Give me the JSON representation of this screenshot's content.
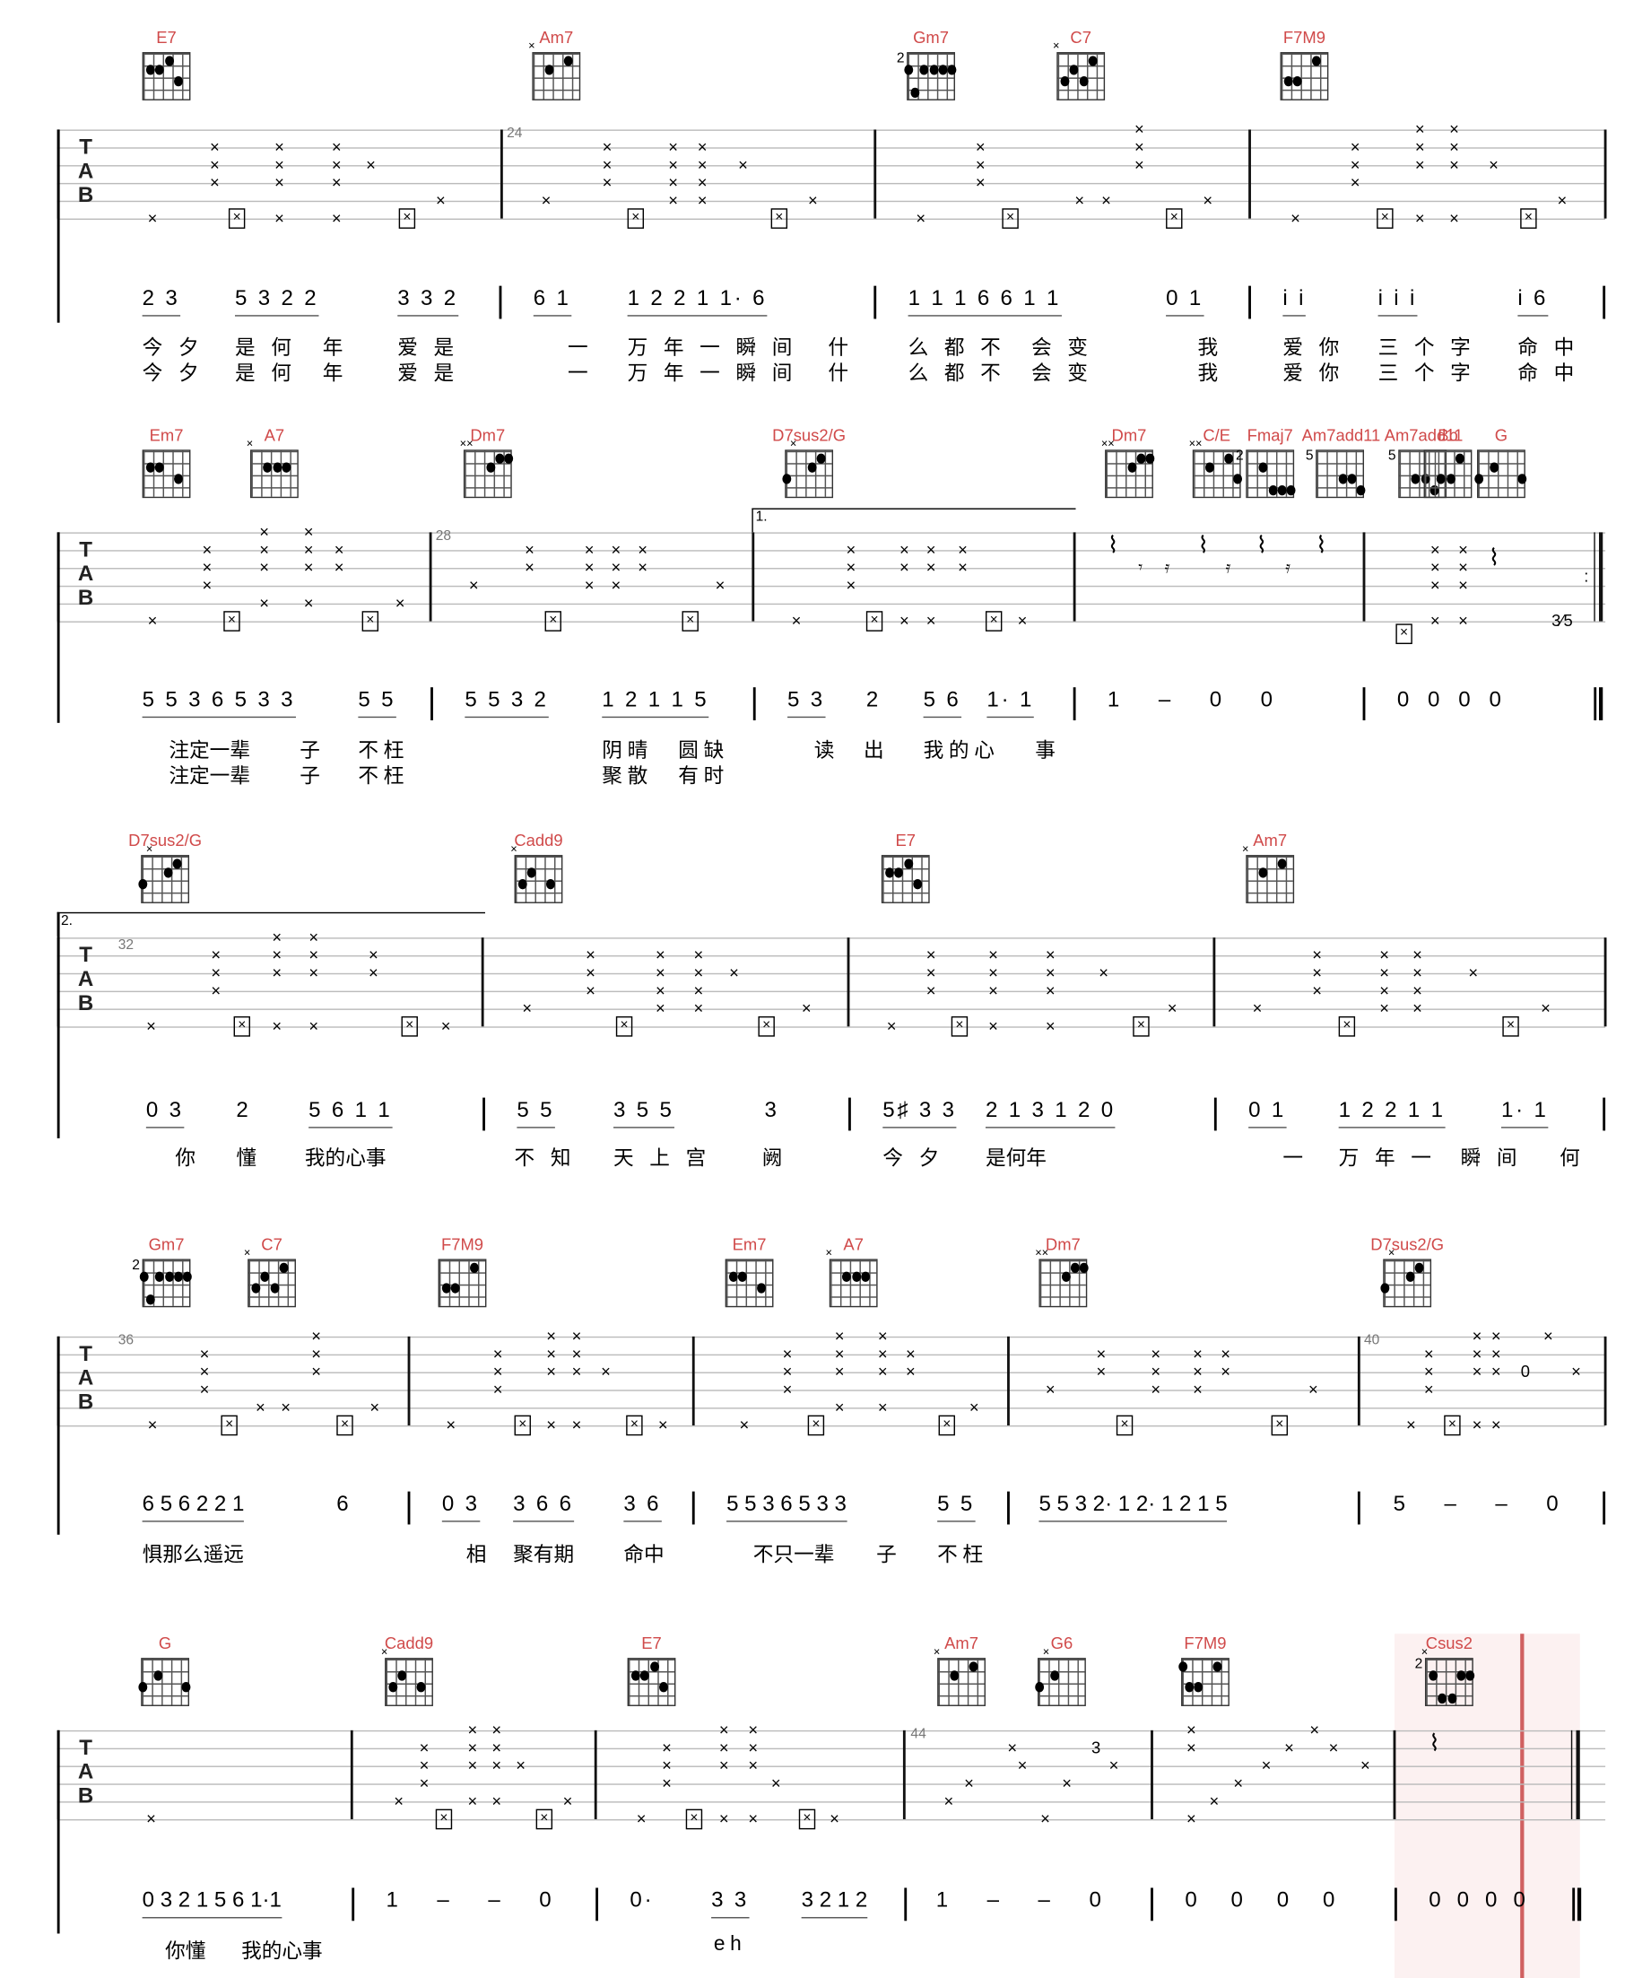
{
  "score": {
    "tab_label": "TAB",
    "systems": [
      {
        "chords": [
          "E7",
          "Am7",
          "Gm7",
          "C7",
          "F7M9"
        ],
        "measure_numbers": [
          "24"
        ],
        "jianpu": [
          "2 3",
          "5 3 2 2",
          "3 3 2",
          "6 1",
          "1 2 2 1 1· 6",
          "1 1 1 6 6 1 1",
          "0 1",
          "i i",
          "i i i",
          "i 6"
        ],
        "lyrics_1": [
          "今 夕",
          "是 何",
          "年",
          "爱 是",
          "一",
          "万 年 一 瞬 间",
          "什",
          "么 都 不",
          "会 变",
          "我",
          "爱 你",
          "三 个 字",
          "命 中"
        ],
        "lyrics_2": [
          "今 夕",
          "是 何",
          "年",
          "爱 是",
          "一",
          "万 年 一 瞬 间",
          "什",
          "么 都 不",
          "会 变",
          "我",
          "爱 你",
          "三 个 字",
          "命 中"
        ]
      },
      {
        "chords": [
          "Em7",
          "A7",
          "Dm7",
          "D7sus2/G",
          "Dm7",
          "C/E",
          "Fmaj7",
          "Am7add11",
          "Am7add11",
          "Bb",
          "G"
        ],
        "measure_numbers": [
          "28"
        ],
        "volta": "1.",
        "fret_label": "3⁄5",
        "jianpu": [
          "5 5 3 6 5 3 3",
          "5 5",
          "5 5 3 2",
          "1 2 1 1 5",
          "5 3",
          "2",
          "5 6",
          "1· 1",
          "1 – 0 0",
          "0 0 0 0"
        ],
        "lyrics_1": [
          "注定一辈",
          "子",
          "不枉",
          "阴晴",
          "圆缺",
          "读",
          "出",
          "我的心",
          "事"
        ],
        "lyrics_2": [
          "注定一辈",
          "子",
          "不枉",
          "聚散",
          "有时"
        ]
      },
      {
        "chords": [
          "D7sus2/G",
          "Cadd9",
          "E7",
          "Am7"
        ],
        "measure_numbers": [
          "32"
        ],
        "volta": "2.",
        "jianpu": [
          "0 3",
          "2",
          "5 6 1 1",
          "5 5",
          "3 5 5",
          "3",
          "5♯ 3 3",
          "2 1 3 1 2 0",
          "0 1",
          "1 2 2 1 1",
          "1· 1"
        ],
        "lyrics_1": [
          "你",
          "懂",
          "我的心事",
          "不 知",
          "天 上 宫",
          "阙",
          "今 夕",
          "是何年",
          "一",
          "万 年 一",
          "瞬 间",
          "何"
        ]
      },
      {
        "chords": [
          "Gm7",
          "C7",
          "F7M9",
          "Em7",
          "A7",
          "Dm7",
          "D7sus2/G"
        ],
        "measure_numbers": [
          "36",
          "40"
        ],
        "fret_label": "0",
        "jianpu": [
          "6 5 6 2 2 1",
          "6",
          "0 3",
          "3 6 6",
          "3 6",
          "5 5 3 6 5 3 3",
          "5 5",
          "5 5 3 2· 1 2· 1 2 1 5",
          "5 – – 0"
        ],
        "lyrics_1": [
          "惧那么遥远",
          "相",
          "聚有期",
          "命中",
          "不只一辈",
          "子",
          "不枉"
        ]
      },
      {
        "chords": [
          "G",
          "Cadd9",
          "E7",
          "Am7",
          "G6",
          "F7M9",
          "Csus2"
        ],
        "measure_numbers": [
          "44"
        ],
        "fret_label": "3",
        "jianpu": [
          "0 3 2 1 5 6 1·1",
          "1 – – 0",
          "0·",
          "3 3",
          "3 2 1 2",
          "1 – – 0",
          "0 0 0 0",
          "0 0 0 0"
        ],
        "lyrics_1": [
          "你懂",
          "我的心事",
          "eh"
        ]
      }
    ]
  },
  "colors": {
    "chord_name": "#d04a4a",
    "playhead_line": "#d06060",
    "playhead_bg": "#fbeeee"
  }
}
